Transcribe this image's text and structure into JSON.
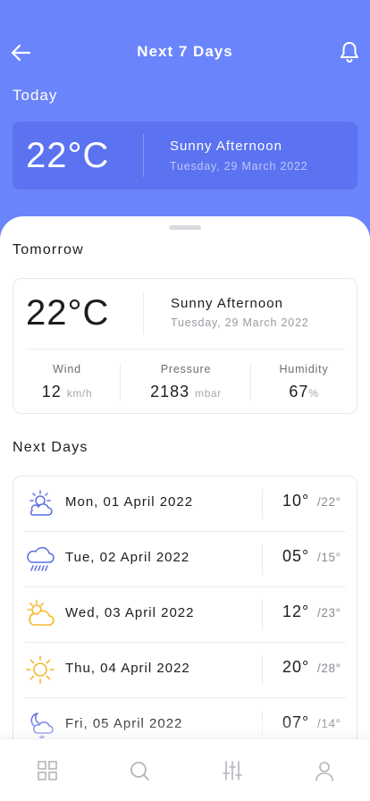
{
  "header": {
    "title": "Next 7 Days",
    "back_icon": "arrow-left-icon",
    "bell_icon": "bell-icon"
  },
  "today": {
    "label": "Today",
    "temperature": "22°C",
    "condition": "Sunny Afternoon",
    "date": "Tuesday, 29 March 2022"
  },
  "tomorrow": {
    "label": "Tomorrow",
    "temperature": "22°C",
    "condition": "Sunny Afternoon",
    "date": "Tuesday, 29 March 2022",
    "stats": [
      {
        "label": "Wind",
        "value": "12",
        "unit": "km/h"
      },
      {
        "label": "Pressure",
        "value": "2183",
        "unit": "mbar"
      },
      {
        "label": "Humidity",
        "value": "67",
        "unit": "%"
      }
    ]
  },
  "next_days": {
    "label": "Next Days",
    "items": [
      {
        "day": "Mon, 01 April 2022",
        "high": "10°",
        "low": "/22°",
        "icon": "partly-cloudy-icon"
      },
      {
        "day": "Tue, 02 April 2022",
        "high": "05°",
        "low": "/15°",
        "icon": "rain-cloud-icon"
      },
      {
        "day": "Wed, 03 April 2022",
        "high": "12°",
        "low": "/23°",
        "icon": "sun-behind-cloud-icon"
      },
      {
        "day": "Thu, 04 April 2022",
        "high": "20°",
        "low": "/28°",
        "icon": "sun-icon"
      },
      {
        "day": "Fri, 05 April 2022",
        "high": "07°",
        "low": "/14°",
        "icon": "moon-snow-cloud-icon"
      }
    ]
  },
  "bottom_nav": {
    "items": [
      "grid-icon",
      "search-icon",
      "filter-sliders-icon",
      "profile-icon"
    ]
  },
  "colors": {
    "accent": "#6a84fb",
    "card": "#5b73f0",
    "icon_blue": "#5b6fe0",
    "icon_sun": "#f5b82e"
  }
}
